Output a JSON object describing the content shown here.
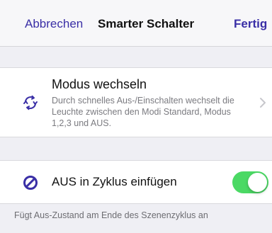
{
  "navbar": {
    "cancel_label": "Abbrechen",
    "title": "Smarter Schalter",
    "done_label": "Fertig"
  },
  "mode_cell": {
    "title": "Modus wechseln",
    "description": "Durch schnelles Aus-/Einschalten wechselt die Leuchte zwischen den Modi Standard, Modus 1,2,3 und AUS.",
    "icon": "cycle-arrows-icon"
  },
  "off_cell": {
    "label": "AUS in Zyklus einfügen",
    "icon": "prohibited-icon",
    "toggle_on": true
  },
  "footer": {
    "text": "Fügt Aus-Zustand am Ende des Szenenzyklus an"
  },
  "colors": {
    "accent": "#3a2fa6",
    "toggle_on": "#4bd964",
    "background": "#efeff4"
  }
}
